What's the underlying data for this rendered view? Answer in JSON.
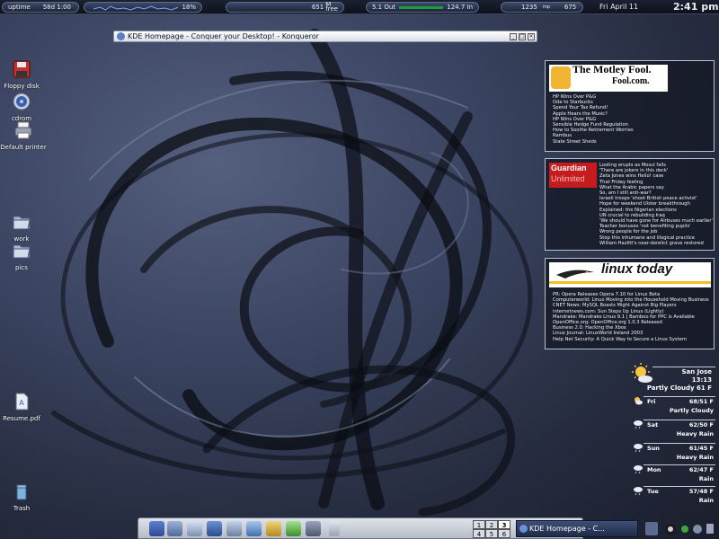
{
  "topbar": {
    "uptime_label": "uptime",
    "uptime_value": "58d 1:00",
    "cpu_value": "18%",
    "mem_value": "651",
    "mem_unit_top": "M",
    "mem_unit_bottom": "free",
    "net_out": "5.1 Out",
    "net_in": "124.7 In",
    "temp_value": "1235",
    "temp_unit": "mp",
    "extra_value": "675",
    "date": "Fri April 11",
    "time": "2:41 pm"
  },
  "desktop_icons": [
    {
      "label": "Floppy disk",
      "icon": "floppy-icon"
    },
    {
      "label": "cdrom",
      "icon": "cdrom-icon"
    },
    {
      "label": "Default printer",
      "icon": "printer-icon"
    },
    {
      "label": "work",
      "icon": "folder-icon"
    },
    {
      "label": "pics",
      "icon": "folder-icon"
    },
    {
      "label": "Resume.pdf",
      "icon": "pdf-icon"
    },
    {
      "label": "Trash",
      "icon": "trash-icon"
    }
  ],
  "window": {
    "title": "KDE Homepage - Conquer your Desktop! - Konqueror",
    "buttons": [
      "_",
      "□",
      "×"
    ]
  },
  "fool": {
    "logo_line1": "The Motley Fool.",
    "logo_line2": "Fool.com.",
    "headlines": [
      "HP Wins Over P&G",
      "Ode to Starbucks",
      "Spend Your Tax Refund!",
      "Apple Hears the Music?",
      "HP Wins Over P&G",
      "Sensible Hedge Fund Regulation",
      "How to Soothe Retirement Worries",
      "Rambus",
      "State Street Sheds"
    ]
  },
  "guardian": {
    "logo_line1": "Guardian",
    "logo_line2": "Unlimited",
    "headlines": [
      "Looting erupts as Mosul falls",
      "'There are jokers in this deck'",
      "Zeta Jones wins Hello! case",
      "That Friday feeling",
      "What the Arabic papers say",
      "So, am I still anti-war?",
      "Israeli troops 'shoot British peace activist'",
      "Hope for weekend Ulster breakthrough",
      "Explained: the Nigerian elections",
      "UN crucial to rebuilding Iraq",
      "'We should have gone for Airbuses much earlier'",
      "Teacher bonuses 'not benefiting pupils'",
      "Wrong people for the job",
      "Stop this inhumane and illogical practice",
      "William Hazlitt's near-derelict grave restored"
    ]
  },
  "linuxtoday": {
    "logo_text": "linux today",
    "headlines": [
      "PR: Opera Releases Opera 7.10 for Linux Beta",
      "Computerworld: Linux Moving into the Household Moving Business",
      "CNET News: MySQL Boasts Might Against Big Players",
      "internetnews.com: Sun Steps Up Linux (Lightly)",
      "Mandrake: Mandrake Linux 9.1 | Bamboo for PPC is Available",
      "OpenOffice.org: OpenOffice.org 1.0.3 Released",
      "Business 2.0: Hacking the Xbox",
      "Linux Journal: LinuxWorld Ireland 2003",
      "Help Net Security: A Quick Way to Secure a Linux System"
    ]
  },
  "weather": {
    "city": "San Jose",
    "time": "13:13",
    "current": "Partly Cloudy  61 F",
    "forecast": [
      {
        "day": "Fri",
        "temp": "68/51 F",
        "cond": "Partly Cloudy",
        "icon": "partly-cloudy-icon"
      },
      {
        "day": "Sat",
        "temp": "62/50 F",
        "cond": "Heavy Rain",
        "icon": "rain-icon"
      },
      {
        "day": "Sun",
        "temp": "61/45 F",
        "cond": "Heavy Rain",
        "icon": "rain-icon"
      },
      {
        "day": "Mon",
        "temp": "62/47 F",
        "cond": "Rain",
        "icon": "rain-icon"
      },
      {
        "day": "Tue",
        "temp": "57/48 F",
        "cond": "Rain",
        "icon": "rain-icon"
      }
    ]
  },
  "taskbar": {
    "pager": [
      "1",
      "2",
      "3",
      "4",
      "5",
      "6"
    ],
    "active_desktop": "3",
    "task_label": "KDE Homepage - C..."
  }
}
